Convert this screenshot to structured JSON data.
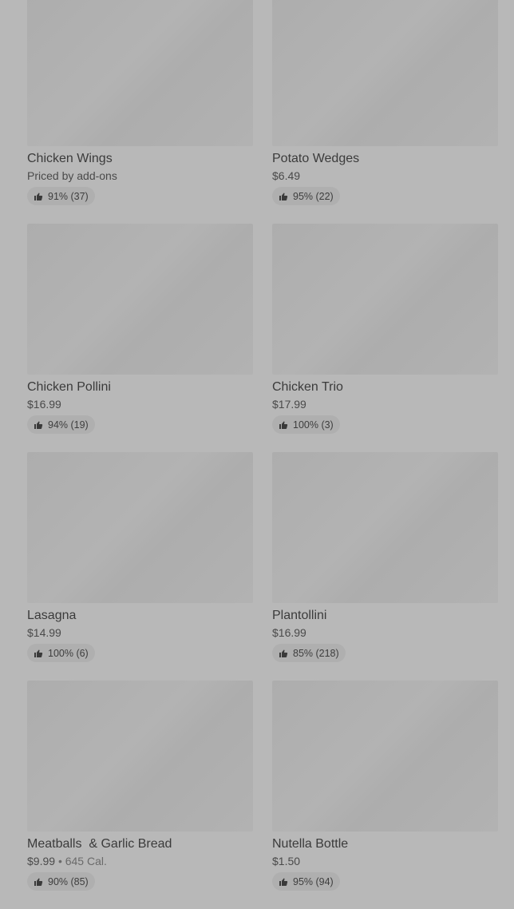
{
  "items": [
    {
      "name": "Chicken Wings",
      "price": "Priced by add-ons",
      "rating": "91% (37)"
    },
    {
      "name": "Potato Wedges",
      "price": "$6.49",
      "rating": "95% (22)"
    },
    {
      "name": "Chicken Pollini",
      "price": "$16.99",
      "rating": "94% (19)"
    },
    {
      "name": "Chicken Trio",
      "price": "$17.99",
      "rating": "100% (3)"
    },
    {
      "name": "Lasagna",
      "price": "$14.99",
      "rating": "100% (6)"
    },
    {
      "name": "Plantollini",
      "price": "$16.99",
      "rating": "85% (218)"
    },
    {
      "name": "Meatballs  & Garlic Bread",
      "price": "$9.99",
      "separator": "•",
      "calories": "645 Cal.",
      "rating": "90% (85)"
    },
    {
      "name": "Nutella Bottle",
      "price": "$1.50",
      "rating": "95% (94)"
    }
  ],
  "icons": {
    "rating": "thumbs-up-icon"
  }
}
